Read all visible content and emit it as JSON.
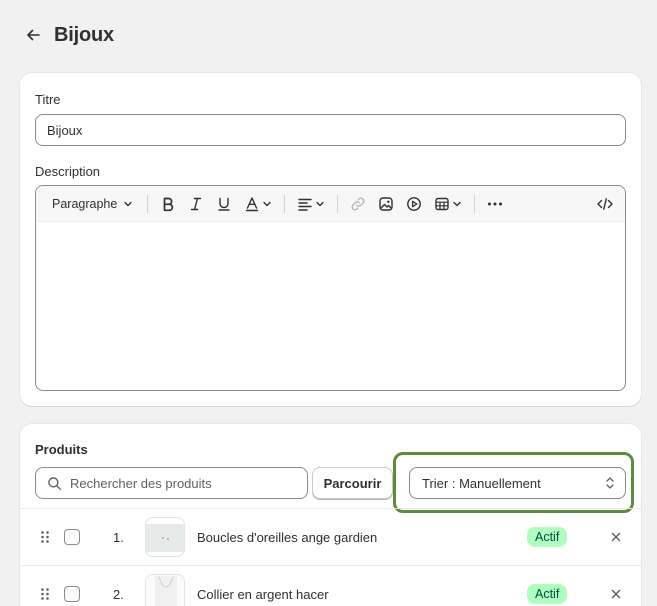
{
  "header": {
    "title": "Bijoux"
  },
  "form": {
    "title_label": "Titre",
    "title_value": "Bijoux",
    "description_label": "Description",
    "toolbar": {
      "paragraph_label": "Paragraphe"
    }
  },
  "products": {
    "title": "Produits",
    "search_placeholder": "Rechercher des produits",
    "browse_label": "Parcourir",
    "sort_label": "Trier : Manuellement",
    "items": [
      {
        "index": "1.",
        "name": "Boucles d'oreilles ange gardien",
        "status": "Actif"
      },
      {
        "index": "2.",
        "name": "Collier en argent hacer",
        "status": "Actif"
      }
    ]
  },
  "colors": {
    "highlight": "#5e8a3e",
    "badge_bg": "#affebf",
    "badge_text": "#014b40"
  }
}
